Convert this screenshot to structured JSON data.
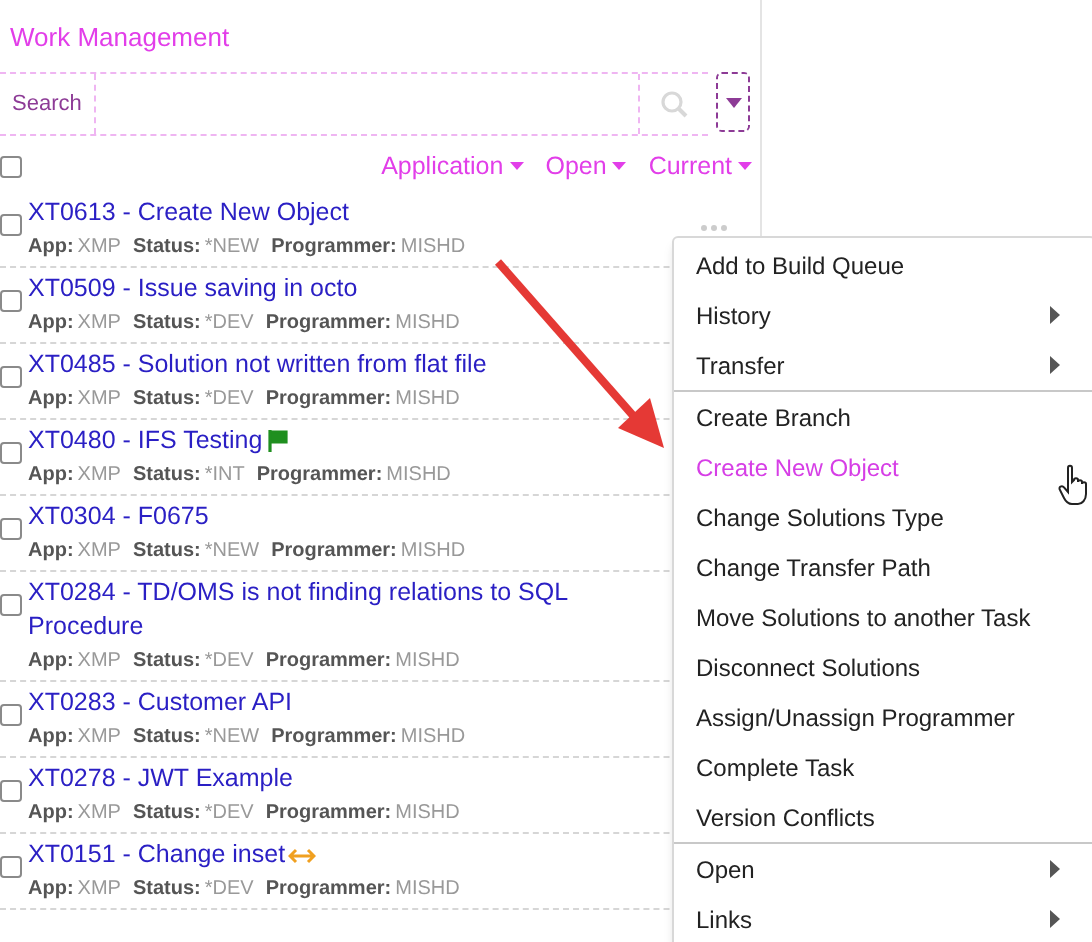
{
  "header": {
    "title": "Work Management"
  },
  "search": {
    "label": "Search"
  },
  "filters": [
    {
      "label": "Application"
    },
    {
      "label": "Open"
    },
    {
      "label": "Current"
    }
  ],
  "select_all": {
    "checked": false
  },
  "tasks": [
    {
      "title": "XT0613 - Create New Object",
      "checked": false,
      "meta": [
        {
          "label": "App:",
          "value": "XMP"
        },
        {
          "label": "Status:",
          "value": "*NEW"
        },
        {
          "label": "Programmer:",
          "value": "MISHD"
        }
      ]
    },
    {
      "title": "XT0509 - Issue saving in octo",
      "checked": false,
      "meta": [
        {
          "label": "App:",
          "value": "XMP"
        },
        {
          "label": "Status:",
          "value": "*DEV"
        },
        {
          "label": "Programmer:",
          "value": "MISHD"
        }
      ]
    },
    {
      "title": "XT0485 - Solution not written from flat file",
      "checked": false,
      "meta": [
        {
          "label": "App:",
          "value": "XMP"
        },
        {
          "label": "Status:",
          "value": "*DEV"
        },
        {
          "label": "Programmer:",
          "value": "MISHD"
        }
      ]
    },
    {
      "title": "XT0480 - IFS Testing",
      "checked": false,
      "kind": "flagged",
      "meta": [
        {
          "label": "App:",
          "value": "XMP"
        },
        {
          "label": "Status:",
          "value": "*INT"
        },
        {
          "label": "Programmer:",
          "value": "MISHD"
        }
      ]
    },
    {
      "title": "XT0304 - F0675",
      "checked": false,
      "meta": [
        {
          "label": "App:",
          "value": "XMP"
        },
        {
          "label": "Status:",
          "value": "*NEW"
        },
        {
          "label": "Programmer:",
          "value": "MISHD"
        }
      ]
    },
    {
      "title": "XT0284 - TD/OMS is not finding relations to SQL Procedure",
      "checked": false,
      "meta": [
        {
          "label": "App:",
          "value": "XMP"
        },
        {
          "label": "Status:",
          "value": "*DEV"
        },
        {
          "label": "Programmer:",
          "value": "MISHD"
        }
      ]
    },
    {
      "title": "XT0283 - Customer API",
      "checked": false,
      "meta": [
        {
          "label": "App:",
          "value": "XMP"
        },
        {
          "label": "Status:",
          "value": "*NEW"
        },
        {
          "label": "Programmer:",
          "value": "MISHD"
        }
      ]
    },
    {
      "title": "XT0278 - JWT Example",
      "checked": false,
      "meta": [
        {
          "label": "App:",
          "value": "XMP"
        },
        {
          "label": "Status:",
          "value": "*DEV"
        },
        {
          "label": "Programmer:",
          "value": "MISHD"
        }
      ]
    },
    {
      "title": "XT0151 - Change inset",
      "checked": false,
      "kind": "transferring",
      "meta": [
        {
          "label": "App:",
          "value": "XMP"
        },
        {
          "label": "Status:",
          "value": "*DEV"
        },
        {
          "label": "Programmer:",
          "value": "MISHD"
        }
      ]
    }
  ],
  "context_menu": {
    "groups": [
      [
        {
          "label": "Add to Build Queue",
          "submenu": false,
          "highlighted": false
        },
        {
          "label": "History",
          "submenu": true,
          "highlighted": false
        },
        {
          "label": "Transfer",
          "submenu": true,
          "highlighted": false
        }
      ],
      [
        {
          "label": "Create Branch",
          "submenu": false,
          "highlighted": false
        },
        {
          "label": "Create New Object",
          "submenu": false,
          "highlighted": true
        },
        {
          "label": "Change Solutions Type",
          "submenu": false,
          "highlighted": false
        },
        {
          "label": "Change Transfer Path",
          "submenu": false,
          "highlighted": false
        },
        {
          "label": "Move Solutions to another Task",
          "submenu": false,
          "highlighted": false
        },
        {
          "label": "Disconnect Solutions",
          "submenu": false,
          "highlighted": false
        },
        {
          "label": "Assign/Unassign Programmer",
          "submenu": false,
          "highlighted": false
        },
        {
          "label": "Complete Task",
          "submenu": false,
          "highlighted": false
        },
        {
          "label": "Version Conflicts",
          "submenu": false,
          "highlighted": false
        }
      ],
      [
        {
          "label": "Open",
          "submenu": true,
          "highlighted": false
        },
        {
          "label": "Links",
          "submenu": true,
          "highlighted": false
        }
      ]
    ]
  }
}
